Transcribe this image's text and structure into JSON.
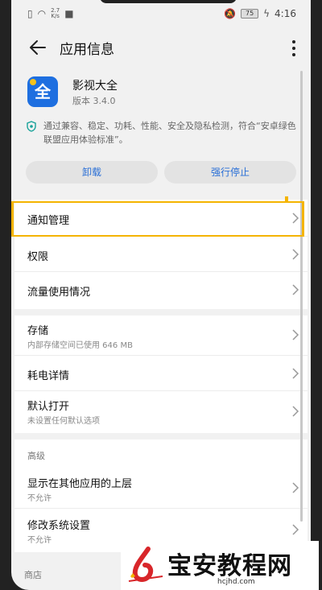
{
  "status_bar": {
    "net_speed_value": "2.7",
    "net_speed_unit": "K/s",
    "battery": "75",
    "time": "4:16"
  },
  "app_bar": {
    "title": "应用信息"
  },
  "app": {
    "name": "影视大全",
    "version": "版本 3.4.0",
    "logo_char": "全",
    "logo_color": "#1e6fe0"
  },
  "security_note": "通过兼容、稳定、功耗、性能、安全及隐私检测，符合“安卓绿色联盟应用体验标准”。",
  "buttons": {
    "uninstall": "卸载",
    "force_stop": "强行停止"
  },
  "list": {
    "notifications": "通知管理",
    "permissions": "权限",
    "data_usage": "流量使用情况",
    "storage": {
      "title": "存储",
      "sub": "内部存储空间已使用 646 MB"
    },
    "battery_details": "耗电详情",
    "open_by_default": {
      "title": "默认打开",
      "sub": "未设置任何默认选项"
    },
    "advanced_label": "高级",
    "display_over_apps": {
      "title": "显示在其他应用的上层",
      "sub": "不允许"
    },
    "modify_system": {
      "title": "修改系统设置",
      "sub": "不允许"
    },
    "next_section_label": "商店"
  },
  "watermark": {
    "title": "宝安教程网",
    "url": "hcjhd.com"
  },
  "colors": {
    "accent": "#2a6fd6",
    "highlight": "#f4b400",
    "shield": "#1aa39a"
  }
}
